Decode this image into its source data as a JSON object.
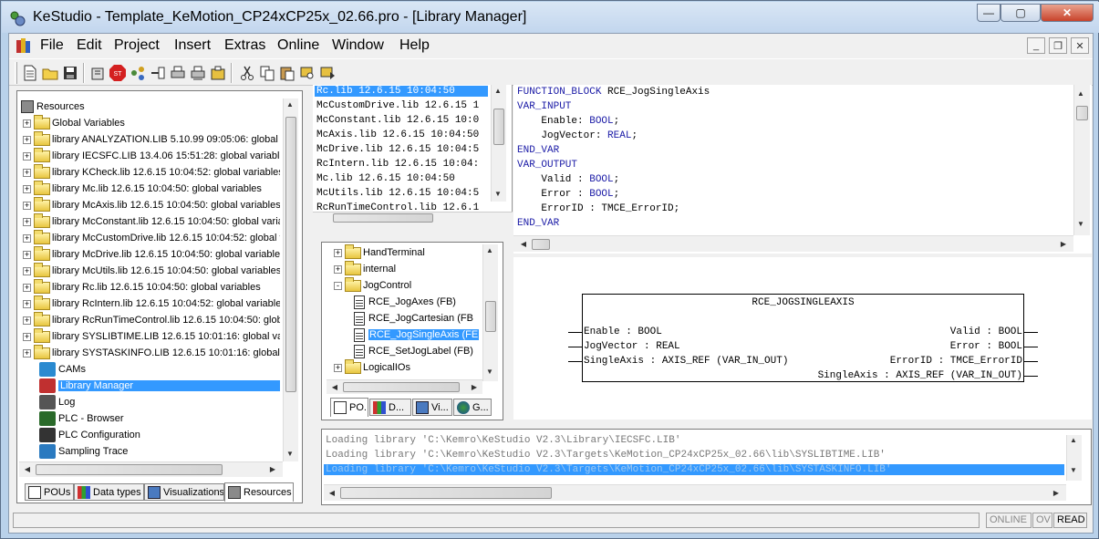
{
  "window": {
    "title": "KeStudio - Template_KeMotion_CP24xCP25x_02.66.pro - [Library Manager]"
  },
  "menu": [
    "File",
    "Edit",
    "Project",
    "Insert",
    "Extras",
    "Online",
    "Window",
    "Help"
  ],
  "resources_tree": [
    {
      "label": "Resources",
      "type": "root"
    },
    {
      "label": "Global Variables",
      "type": "folder"
    },
    {
      "label": "library ANALYZATION.LIB 5.10.99 09:05:06: global",
      "type": "folder"
    },
    {
      "label": "library IECSFC.LIB 13.4.06 15:51:28: global variable",
      "type": "folder"
    },
    {
      "label": "library KCheck.lib 12.6.15 10:04:52: global variables",
      "type": "folder"
    },
    {
      "label": "library Mc.lib 12.6.15 10:04:50: global variables",
      "type": "folder"
    },
    {
      "label": "library McAxis.lib 12.6.15 10:04:50: global variables",
      "type": "folder"
    },
    {
      "label": "library McConstant.lib 12.6.15 10:04:50: global varia",
      "type": "folder"
    },
    {
      "label": "library McCustomDrive.lib 12.6.15 10:04:52: global v",
      "type": "folder"
    },
    {
      "label": "library McDrive.lib 12.6.15 10:04:50: global variables",
      "type": "folder"
    },
    {
      "label": "library McUtils.lib 12.6.15 10:04:50: global variables",
      "type": "folder"
    },
    {
      "label": "library Rc.lib 12.6.15 10:04:50: global variables",
      "type": "folder"
    },
    {
      "label": "library RcIntern.lib 12.6.15 10:04:52: global variable",
      "type": "folder"
    },
    {
      "label": "library RcRunTimeControl.lib 12.6.15 10:04:50: glob",
      "type": "folder"
    },
    {
      "label": "library SYSLIBTIME.LIB 12.6.15 10:01:16: global va",
      "type": "folder"
    },
    {
      "label": "library SYSTASKINFO.LIB 12.6.15 10:01:16: global",
      "type": "folder"
    },
    {
      "label": "CAMs",
      "type": "cam"
    },
    {
      "label": "Library Manager",
      "type": "libman",
      "selected": true
    },
    {
      "label": "Log",
      "type": "log"
    },
    {
      "label": "PLC - Browser",
      "type": "plc"
    },
    {
      "label": "PLC Configuration",
      "type": "plccfg"
    },
    {
      "label": "Sampling Trace",
      "type": "trace"
    }
  ],
  "left_tabs": [
    "POUs",
    "Data types",
    "Visualizations",
    "Resources"
  ],
  "library_list": [
    "Rc.lib 12.6.15 10:04:50",
    "McCustomDrive.lib 12.6.15 1",
    "McConstant.lib 12.6.15 10:0",
    "McAxis.lib 12.6.15 10:04:50",
    "McDrive.lib 12.6.15 10:04:5",
    "RcIntern.lib 12.6.15 10:04:",
    "Mc.lib 12.6.15 10:04:50",
    "McUtils.lib 12.6.15 10:04:5",
    "RcRunTimeControl.lib 12.6.1"
  ],
  "pou_tree": [
    {
      "label": "HandTerminal",
      "type": "folder",
      "level": 0,
      "pm": "+"
    },
    {
      "label": "internal",
      "type": "folder",
      "level": 0,
      "pm": "+"
    },
    {
      "label": "JogControl",
      "type": "folder",
      "level": 0,
      "pm": "-"
    },
    {
      "label": "RCE_JogAxes (FB)",
      "type": "doc",
      "level": 1
    },
    {
      "label": "RCE_JogCartesian (FB",
      "type": "doc",
      "level": 1
    },
    {
      "label": "RCE_JogSingleAxis (FE",
      "type": "doc",
      "level": 1,
      "selected": true
    },
    {
      "label": "RCE_SetJogLabel (FB)",
      "type": "doc",
      "level": 1
    },
    {
      "label": "LogicalIOs",
      "type": "folder",
      "level": 0,
      "pm": "+"
    }
  ],
  "mid_tabs": [
    "PO...",
    "D...",
    "Vi...",
    "G..."
  ],
  "declaration": [
    {
      "text": "FUNCTION_BLOCK RCE_JogSingleAxis",
      "kw": "FUNCTION_BLOCK"
    },
    {
      "text": "VAR_INPUT",
      "kw": "VAR_INPUT"
    },
    {
      "text": "    Enable: BOOL;",
      "kw": "BOOL"
    },
    {
      "text": "    JogVector: REAL;",
      "kw": "REAL"
    },
    {
      "text": "END_VAR",
      "kw": "END_VAR"
    },
    {
      "text": "VAR_OUTPUT",
      "kw": "VAR_OUTPUT"
    },
    {
      "text": "    Valid : BOOL;",
      "kw": "BOOL"
    },
    {
      "text": "    Error : BOOL;",
      "kw": "BOOL"
    },
    {
      "text": "    ErrorID : TMCE_ErrorID;",
      "kw": ""
    },
    {
      "text": "END_VAR",
      "kw": "END_VAR"
    }
  ],
  "fb": {
    "name": "RCE_JOGSINGLEAXIS",
    "inputs": [
      "Enable : BOOL",
      "JogVector : REAL",
      "SingleAxis : AXIS_REF (VAR_IN_OUT)"
    ],
    "outputs": [
      "Valid : BOOL",
      "Error : BOOL",
      "ErrorID : TMCE_ErrorID",
      "SingleAxis : AXIS_REF (VAR_IN_OUT)"
    ]
  },
  "messages": [
    "Loading library 'C:\\Kemro\\KeStudio V2.3\\Library\\IECSFC.LIB'",
    "Loading library 'C:\\Kemro\\KeStudio V2.3\\Targets\\KeMotion_CP24xCP25x_02.66\\lib\\SYSLIBTIME.LIB'",
    "Loading library 'C:\\Kemro\\KeStudio V2.3\\Targets\\KeMotion_CP24xCP25x_02.66\\lib\\SYSTASKINFO.LIB'"
  ],
  "status": {
    "online": "ONLINE",
    "ov": "OV",
    "read": "READ"
  },
  "colors": {
    "selection": "#3399ff",
    "keyword": "#1a1aa6",
    "folder": "#e8c640"
  }
}
